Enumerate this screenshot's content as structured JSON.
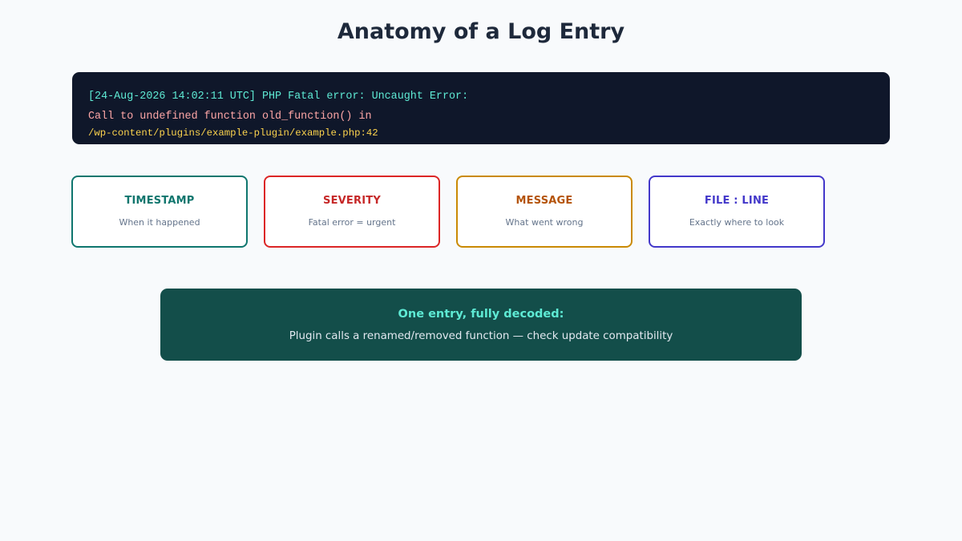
{
  "title": "Anatomy of a Log Entry",
  "log": {
    "line1": "[24-Aug-2026 14:02:11 UTC] PHP Fatal error: Uncaught Error:",
    "line2": "Call to undefined function old_function() in",
    "line3": "/wp-content/plugins/example-plugin/example.php:42"
  },
  "parts": [
    {
      "title": "TIMESTAMP",
      "description": "When it happened",
      "color": "#0f766e"
    },
    {
      "title": "SEVERITY",
      "description": "Fatal error = urgent",
      "color": "#dc2626"
    },
    {
      "title": "MESSAGE",
      "description": "What went wrong",
      "color": "#ca8a04"
    },
    {
      "title": "FILE : LINE",
      "description": "Exactly where to look",
      "color": "#4338ca"
    }
  ],
  "summary": {
    "title": "One entry, fully decoded:",
    "text": "Plugin calls a renamed/removed function — check update compatibility"
  }
}
